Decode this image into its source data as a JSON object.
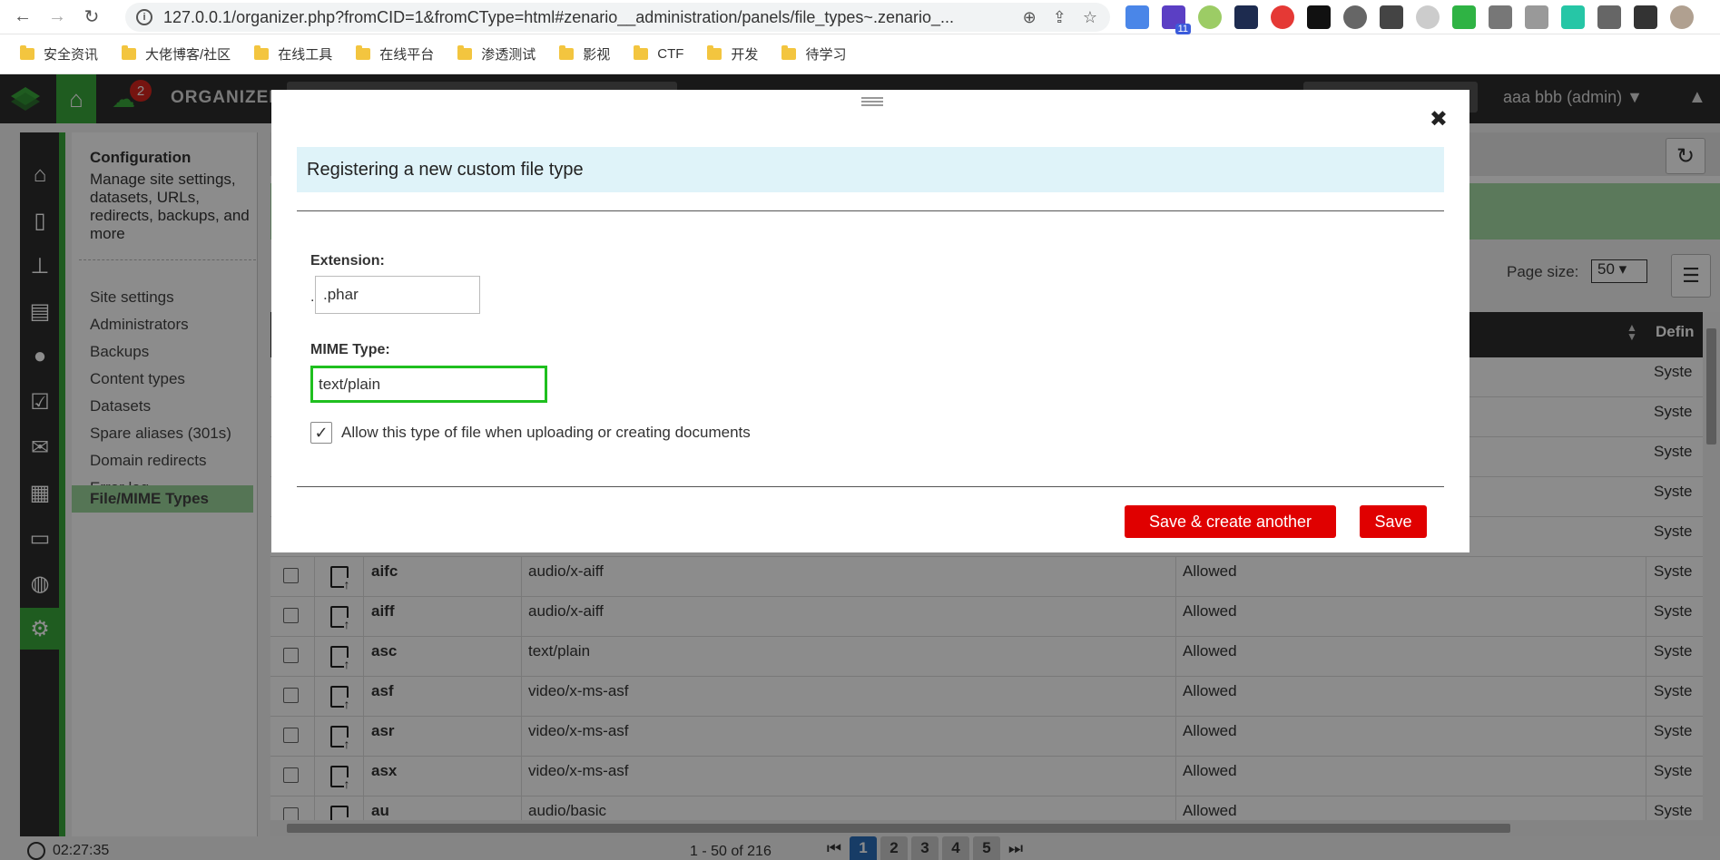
{
  "browser": {
    "url": "127.0.0.1/organizer.php?fromCID=1&fromCType=html#zenario__administration/panels/file_types~.zenario_...",
    "extension_badge": "11",
    "bookmarks": [
      "安全资讯",
      "大佬博客/社区",
      "在线工具",
      "在线平台",
      "渗透测试",
      "影视",
      "CTF",
      "开发",
      "待学习"
    ]
  },
  "app": {
    "title": "ORGANIZER",
    "notification_count": "2",
    "user": "aaa bbb (admin) ▼"
  },
  "side_panel": {
    "title": "Configuration",
    "description": "Manage site settings, datasets, URLs, redirects, backups, and more",
    "items": [
      "Site settings",
      "Administrators",
      "Backups",
      "Content types",
      "Datasets",
      "Spare aliases (301s)",
      "Domain redirects",
      "Error log",
      "File/MIME Types"
    ]
  },
  "toolbar": {
    "page_size_label": "Page size:",
    "page_size_value": "50 ▾"
  },
  "table": {
    "defined_header": "Defin",
    "rows": [
      {
        "ext": "aifc",
        "mime": "audio/x-aiff",
        "status": "Allowed",
        "defined": "Syste"
      },
      {
        "ext": "aiff",
        "mime": "audio/x-aiff",
        "status": "Allowed",
        "defined": "Syste"
      },
      {
        "ext": "asc",
        "mime": "text/plain",
        "status": "Allowed",
        "defined": "Syste"
      },
      {
        "ext": "asf",
        "mime": "video/x-ms-asf",
        "status": "Allowed",
        "defined": "Syste"
      },
      {
        "ext": "asr",
        "mime": "video/x-ms-asf",
        "status": "Allowed",
        "defined": "Syste"
      },
      {
        "ext": "asx",
        "mime": "video/x-ms-asf",
        "status": "Allowed",
        "defined": "Syste"
      },
      {
        "ext": "au",
        "mime": "audio/basic",
        "status": "Allowed",
        "defined": "Syste"
      }
    ],
    "hidden_rows_defined": [
      "Syste",
      "Syste",
      "Syste",
      "Syste",
      "Syste"
    ]
  },
  "status_bar": {
    "clock": "02:27:35",
    "result_count": "1 - 50 of 216",
    "pages": [
      "1",
      "2",
      "3",
      "4",
      "5"
    ],
    "current_page": "1"
  },
  "modal": {
    "title": "Registering a new custom file type",
    "extension_label": "Extension:",
    "extension_prefix": ".",
    "extension_value": ".phar",
    "mime_label": "MIME Type:",
    "mime_value": "text/plain",
    "allow_label": "Allow this type of file when uploading or creating documents",
    "allow_checked": true,
    "save_create_label": "Save & create another",
    "save_label": "Save",
    "close_glyph": "✖"
  }
}
